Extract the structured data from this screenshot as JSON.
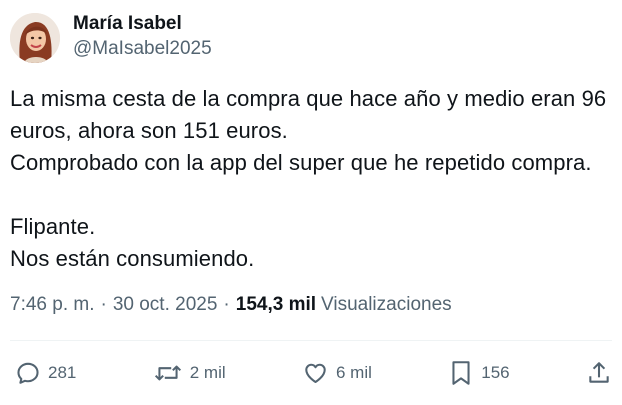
{
  "author": {
    "display_name": "María Isabel",
    "handle": "@MaIsabel2025",
    "avatar": "avatar-illustration"
  },
  "tweet": {
    "lines": [
      "La misma cesta de la compra que hace año y medio eran 96",
      "euros, ahora son 151 euros.",
      "Comprobado con la app del super que he repetido compra.",
      "",
      "Flipante.",
      "Nos están consumiendo."
    ]
  },
  "meta": {
    "time": "7:46 p. m.",
    "separator": "·",
    "date": "30 oct. 2025",
    "views_count": "154,3 mil",
    "views_label": "Visualizaciones"
  },
  "actions": {
    "replies": {
      "icon": "reply-icon",
      "count": "281"
    },
    "reposts": {
      "icon": "repost-icon",
      "count": "2 mil"
    },
    "likes": {
      "icon": "heart-icon",
      "count": "6 mil"
    },
    "bookmarks": {
      "icon": "bookmark-icon",
      "count": "156"
    },
    "share": {
      "icon": "share-icon"
    }
  },
  "colors": {
    "text": "#0f1419",
    "secondary": "#536471",
    "divider": "#eff3f4"
  }
}
